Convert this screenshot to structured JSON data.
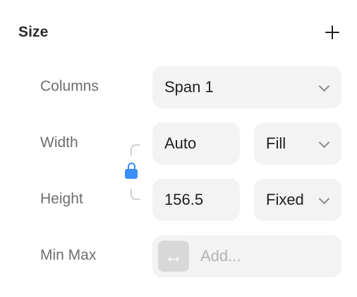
{
  "section": {
    "title": "Size"
  },
  "rows": {
    "columns": {
      "label": "Columns",
      "value": "Span 1"
    },
    "width": {
      "label": "Width",
      "value": "Auto",
      "mode": "Fill"
    },
    "height": {
      "label": "Height",
      "value": "156.5",
      "mode": "Fixed"
    },
    "minmax": {
      "label": "Min Max",
      "placeholder": "Add...",
      "icon": "horizontal-arrows-icon"
    }
  },
  "icons": {
    "add": "plus-icon",
    "lock": "lock-icon",
    "chevron": "chevron-down-icon"
  },
  "colors": {
    "accent": "#3a8ef6",
    "field_bg": "#f3f3f3",
    "label": "#6e6e6e"
  }
}
